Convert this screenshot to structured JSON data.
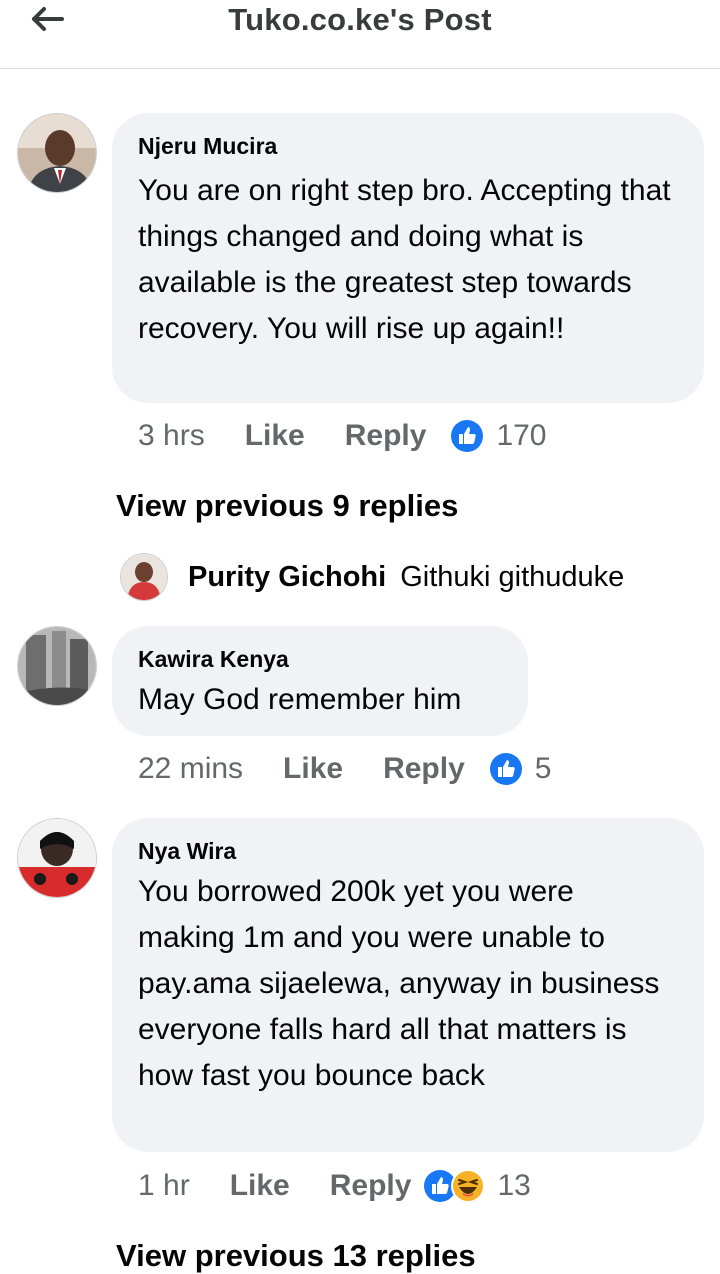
{
  "header": {
    "title": "Tuko.co.ke's Post"
  },
  "comments": [
    {
      "author": "Njeru Mucira",
      "text": "You are on right step bro. Accepting that things changed and doing what is available is the greatest step towards recovery. You will rise up again!!",
      "time": "3 hrs",
      "like_label": "Like",
      "reply_label": "Reply",
      "reactions": "170",
      "view_previous": "View previous 9 replies"
    },
    {
      "author": "Kawira Kenya",
      "text": "May God remember him",
      "time": "22 mins",
      "like_label": "Like",
      "reply_label": "Reply",
      "reactions": "5"
    },
    {
      "author": "Nya Wira",
      "text": "You borrowed 200k yet you were making 1m and you were unable to pay.ama sijaelewa, anyway in business everyone falls hard all that matters is how fast you bounce back",
      "time": "1 hr",
      "like_label": "Like",
      "reply_label": "Reply",
      "reactions": "13",
      "view_previous": "View previous 13 replies"
    }
  ],
  "reply_preview": {
    "author": "Purity Gichohi",
    "text": "Githuki githuduke"
  },
  "colors": {
    "like_blue": "#1877f2",
    "bubble": "#f0f2f5",
    "meta": "#65676b"
  },
  "icons": [
    "back-arrow-icon",
    "like-reaction-icon",
    "haha-reaction-icon"
  ]
}
